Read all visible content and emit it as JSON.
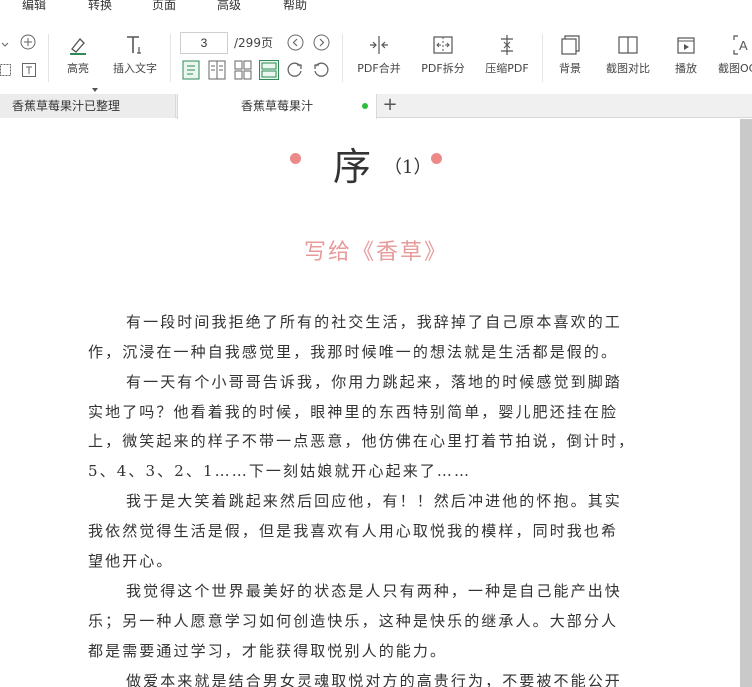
{
  "menu": {
    "items": [
      "编辑",
      "转换",
      "页面",
      "高级",
      "帮助"
    ]
  },
  "toolbar": {
    "highlight_label": "高亮",
    "insert_text_label": "插入文字",
    "current_page": "3",
    "total_pages": "/299页",
    "merge_label": "PDF合并",
    "split_label": "PDF拆分",
    "compress_label": "压缩PDF",
    "background_label": "背景",
    "compare_label": "截图对比",
    "play_label": "播放",
    "ocr_label": "截图OCR"
  },
  "tabs": {
    "tab1": "香蕉草莓果汁已整理",
    "tab2": "香蕉草莓果汁",
    "add": "+"
  },
  "document": {
    "title": "序",
    "title_num": "（1）",
    "subtitle": "写给《香草》",
    "lines": [
      "有一段时间我拒绝了所有的社交生活，我辞掉了自己原本喜欢的工",
      "作，沉浸在一种自我感觉里，我那时候唯一的想法就是生活都是假的。",
      "有一天有个小哥哥告诉我，你用力跳起来，落地的时候感觉到脚踏",
      "实地了吗？他看着我的时候，眼神里的东西特别简单，婴儿肥还挂在脸",
      "上，微笑起来的样子不带一点恶意，他仿佛在心里打着节拍说，倒计时，",
      "5、4、3、2、1……下一刻姑娘就开心起来了……",
      "我于是大笑着跳起来然后回应他，有！！然后冲进他的怀抱。其实",
      "我依然觉得生活是假，但是我喜欢有人用心取悦我的模样，同时我也希",
      "望他开心。",
      "我觉得这个世界最美好的状态是人只有两种，一种是自己能产出快",
      "乐；另一种人愿意学习如何创造快乐，这种是快乐的继承人。大部分人",
      "都是需要通过学习，才能获得取悦别人的能力。",
      "做爱本来就是结合男女灵魂取悦对方的高贵行为，不要被不能公开"
    ]
  },
  "colors": {
    "accent_pink": "#ec8a8a",
    "subtitle_pink": "#e79a9a",
    "icon_green": "#2e8b57",
    "tab_dot": "#2bbd3a"
  }
}
